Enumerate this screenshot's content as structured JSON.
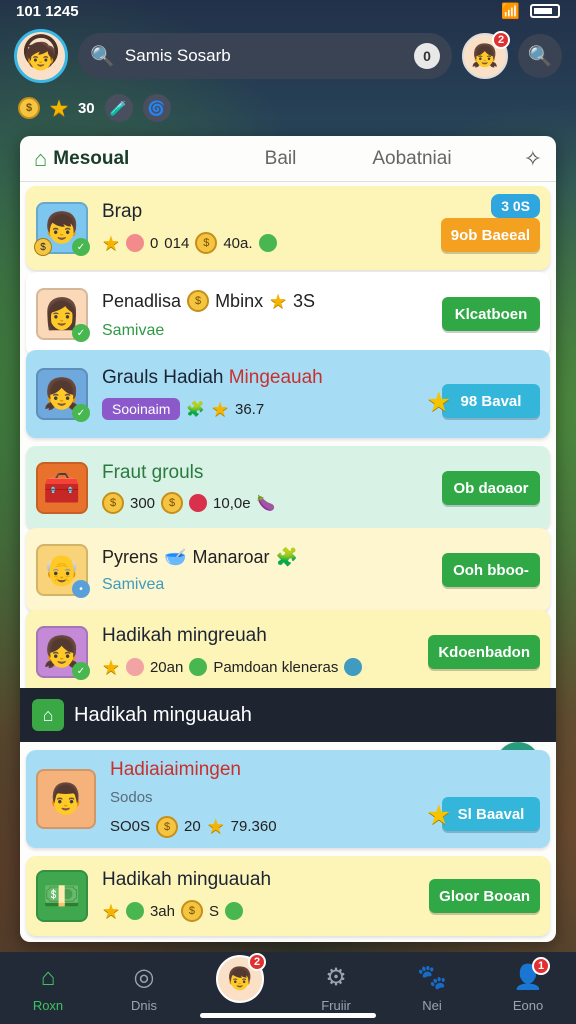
{
  "status": {
    "time": "101 1245"
  },
  "topbar": {
    "search_label": "Samis Sosarb",
    "search_count": "0",
    "notif_badge": "2"
  },
  "resources": {
    "value": "30"
  },
  "panel": {
    "tabs": [
      "Mesoual",
      "Bail",
      "Aobatniai"
    ]
  },
  "rows": [
    {
      "title": "Brap",
      "meta": [
        "0",
        "014",
        "40a."
      ],
      "tag": "3 0S",
      "action": "9ob Baeeal"
    },
    {
      "title": "Penadlisa",
      "meta_after": "Mbinx",
      "num": "3S",
      "sub": "Samivae",
      "action": "Klcatboen"
    },
    {
      "title_a": "Grauls Hadiah ",
      "title_b": "Mingeauah",
      "chip": "Sooinaim",
      "num": "36.7",
      "action": "98 Baval"
    },
    {
      "title": "Fraut grouls",
      "meta": [
        "300",
        "10,0e"
      ],
      "action": "Ob daoaor"
    },
    {
      "title": "Pyrens",
      "meta_after": "Manaroar",
      "sub": "Samivea",
      "action": "Ooh bboo-"
    },
    {
      "title": "Hadikah mingreuah",
      "meta": [
        "20an",
        "Pamdoan kleneras"
      ],
      "action": "Kdoenbadon"
    }
  ],
  "section": {
    "title": "Hadikah minguauah"
  },
  "rows2": [
    {
      "title": "Hadiaiaimingen",
      "sub": "Sodos",
      "meta": [
        "SO0S",
        "20",
        "79.360"
      ],
      "action": "Sl Baaval"
    },
    {
      "title": "Hadikah minguauah",
      "meta": [
        "3ah",
        "S"
      ],
      "action": "Gloor Booan"
    }
  ],
  "nav": [
    "Roxn",
    "Dnis",
    "",
    "Fruiir",
    "Nei",
    "Eono"
  ],
  "nav_badges": {
    "center": "2",
    "last": "1"
  },
  "colors": {
    "accent": "#2fa845",
    "orange": "#f4a020",
    "teal": "#33b6da",
    "panel": "#fdfdfb"
  }
}
